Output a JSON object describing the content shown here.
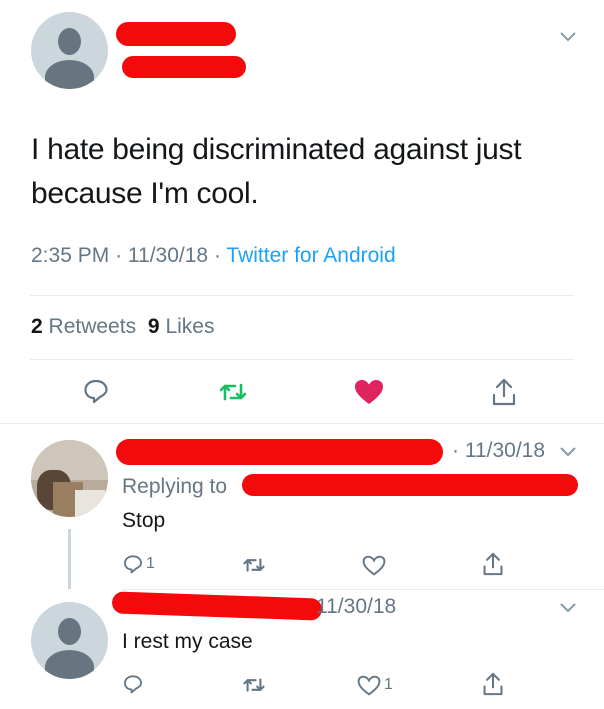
{
  "main_tweet": {
    "text_line1": "I hate being discriminated against just",
    "text_line2": "because I'm cool.",
    "time": "2:35 PM",
    "date": "11/30/18",
    "dot": "·",
    "source": "Twitter for Android",
    "retweets_count": "2",
    "retweets_label": "Retweets",
    "likes_count": "9",
    "likes_label": "Likes"
  },
  "reply1": {
    "date": "· 11/30/18",
    "replying_to": "Replying to",
    "text": "Stop",
    "reply_count": "1",
    "retweet_count": "",
    "like_count": ""
  },
  "reply2": {
    "date": "11/30/18",
    "text": "I rest my case",
    "reply_count": "",
    "retweet_count": "",
    "like_count": "1"
  },
  "icons": {
    "chevron": "chevron-down-icon",
    "reply": "reply-icon",
    "retweet": "retweet-icon",
    "like": "heart-icon",
    "share": "share-icon"
  },
  "colors": {
    "retweet_green": "#17bf63",
    "like_red": "#e0245e",
    "link_blue": "#1da1f2",
    "muted_gray": "#657786",
    "redaction_red": "#f40a0a"
  }
}
